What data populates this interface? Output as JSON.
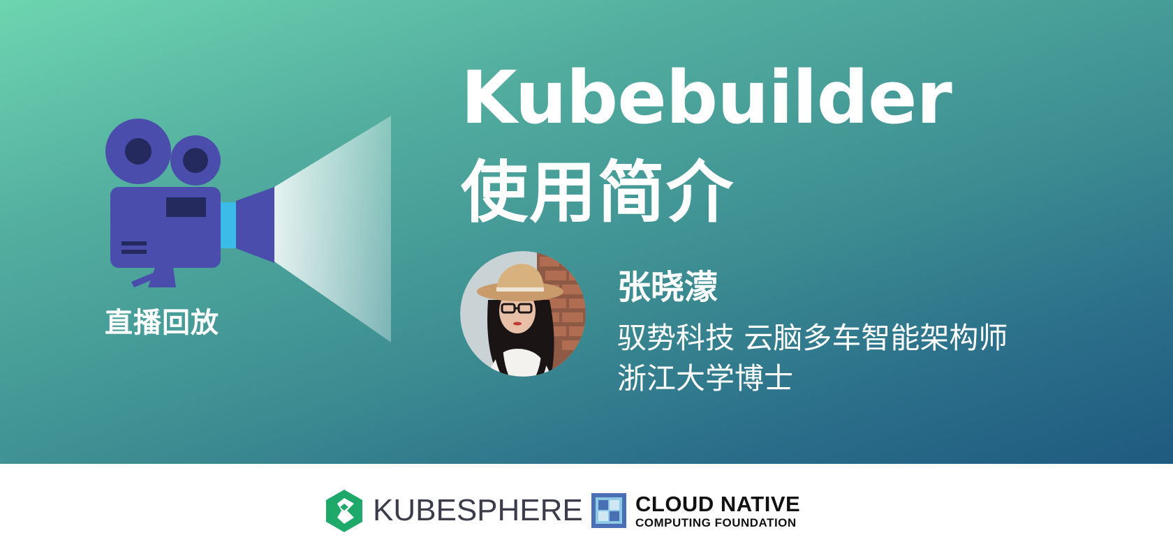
{
  "banner": {
    "replay_label": "直播回放",
    "title_line1": "Kubebuilder",
    "title_line2": "使用简介",
    "speaker": {
      "name": "张晓濛",
      "line1": "驭势科技 云脑多车智能架构师",
      "line2": "浙江大学博士"
    },
    "icons": {
      "camera": "video-camera-icon",
      "avatar": "speaker-avatar"
    },
    "colors": {
      "gradient_start": "#6dd5b0",
      "gradient_end": "#1f5a7f",
      "camera_body": "#4a4dab",
      "camera_dark": "#252a5e",
      "camera_lens_accent": "#3bbce8"
    }
  },
  "footer": {
    "kubesphere_text": "KUBESPHERE",
    "cncf_title": "CLOUD NATIVE",
    "cncf_subtitle": "COMPUTING FOUNDATION",
    "colors": {
      "kubesphere_green": "#1ea86a",
      "cncf_blue": "#4a6fb5"
    }
  }
}
